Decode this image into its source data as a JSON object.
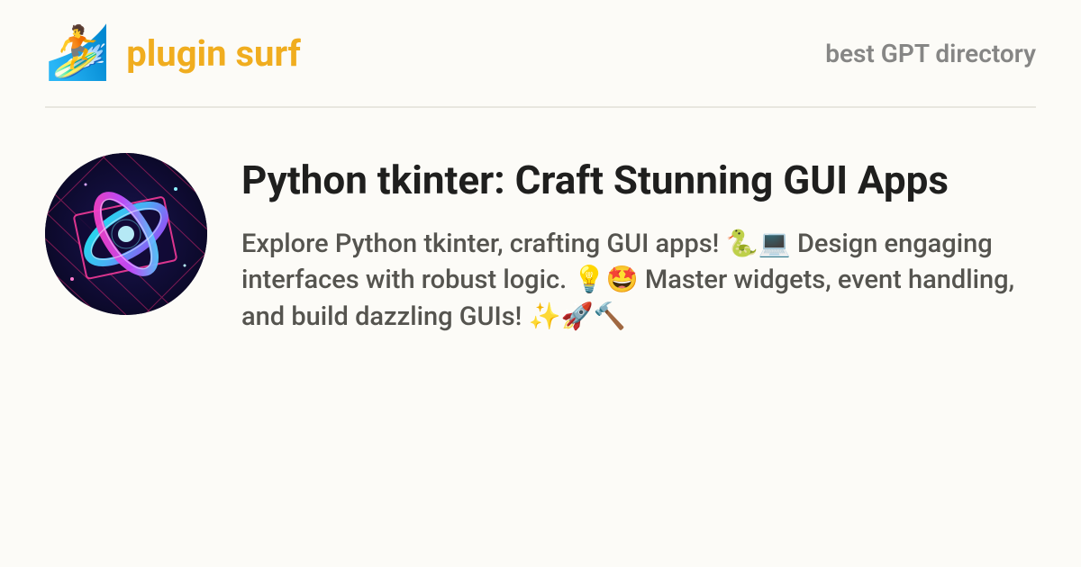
{
  "header": {
    "brand_icon": "🏄",
    "brand_name": "plugin surf",
    "tagline": "best GPT directory"
  },
  "main": {
    "title": "Python tkinter: Craft Stunning GUI Apps",
    "description": "Explore Python tkinter, crafting GUI apps! 🐍💻 Design engaging interfaces with robust logic. 💡🤩 Master widgets, event handling, and build dazzling GUIs! ✨🚀🔨"
  }
}
